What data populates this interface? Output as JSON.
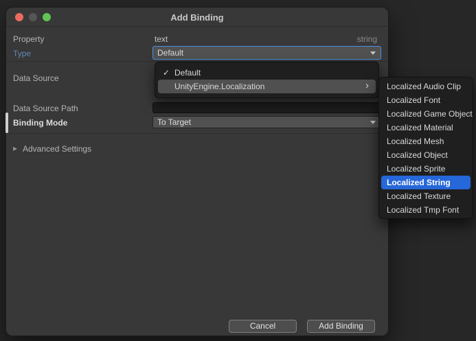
{
  "titlebar": {
    "title": "Add Binding"
  },
  "icons": {
    "checkmark": "✓",
    "chevron_right": "›",
    "disclosure_collapsed": "▶"
  },
  "form": {
    "property": {
      "label": "Property",
      "value": "text",
      "type_hint": "string"
    },
    "type": {
      "label": "Type",
      "value": "Default"
    },
    "data_source": {
      "label": "Data Source"
    },
    "data_source_path": {
      "label": "Data Source Path",
      "value": ""
    },
    "binding_mode": {
      "label": "Binding Mode",
      "value": "To Target"
    },
    "advanced_settings": {
      "label": "Advanced Settings"
    }
  },
  "type_menu": {
    "items": [
      {
        "label": "Default",
        "checked": true
      },
      {
        "label": "UnityEngine.Localization",
        "has_submenu": true
      }
    ]
  },
  "localization_submenu": {
    "items": [
      "Localized Audio Clip",
      "Localized Font",
      "Localized Game Object",
      "Localized Material",
      "Localized Mesh",
      "Localized Object",
      "Localized Sprite",
      "Localized String",
      "Localized Texture",
      "Localized Tmp Font"
    ],
    "selected_item": "Localized String"
  },
  "footer": {
    "cancel": "Cancel",
    "add_binding": "Add Binding"
  },
  "colors": {
    "selection_blue": "#2667d9",
    "focus_border_blue": "#4a90e2",
    "type_label_blue": "#6288b8",
    "window_bg": "#383838",
    "popup_bg": "#1f1f1f"
  }
}
